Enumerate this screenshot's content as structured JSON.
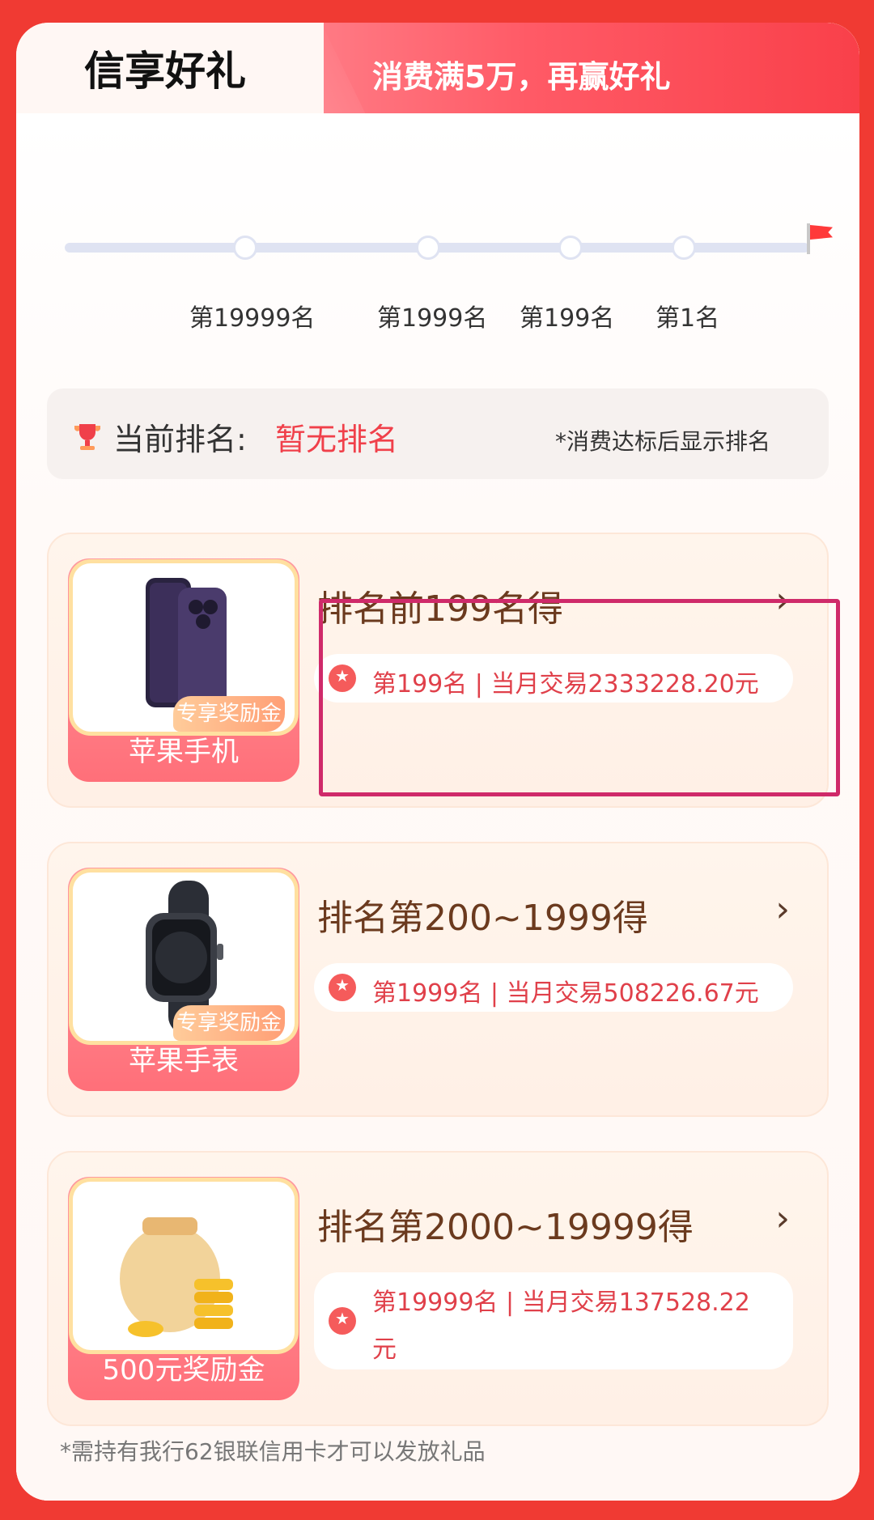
{
  "header": {
    "title": "信享好礼",
    "subtitle": "消费满5万，再赢好礼"
  },
  "progress": {
    "markers": [
      "第19999名",
      "第1999名",
      "第199名",
      "第1名"
    ]
  },
  "current_rank": {
    "label": "当前排名:",
    "value": "暂无排名",
    "note": "*消费达标后显示排名"
  },
  "prizes": [
    {
      "title": "排名前199名得",
      "thumb_caption": "苹果手机",
      "badge": "专享奖励金",
      "detail": "第199名 | 当月交易2333228.20元",
      "icon": "iphone-image"
    },
    {
      "title": "排名第200~1999得",
      "thumb_caption": "苹果手表",
      "badge": "专享奖励金",
      "detail": "第1999名 | 当月交易508226.67元",
      "icon": "apple-watch-image"
    },
    {
      "title": "排名第2000~19999得",
      "thumb_caption": "500元奖励金",
      "detail_line1": "第19999名 | 当月交易137528.22",
      "detail_line2": "元",
      "icon": "coin-bag-image"
    }
  ],
  "footer": {
    "note": "*需持有我行62银联信用卡才可以发放礼品"
  },
  "colors": {
    "brand_red": "#f03a33",
    "accent": "#f0404a",
    "title_brown": "#6b3a1e",
    "highlight_border": "#cf2a6a"
  }
}
